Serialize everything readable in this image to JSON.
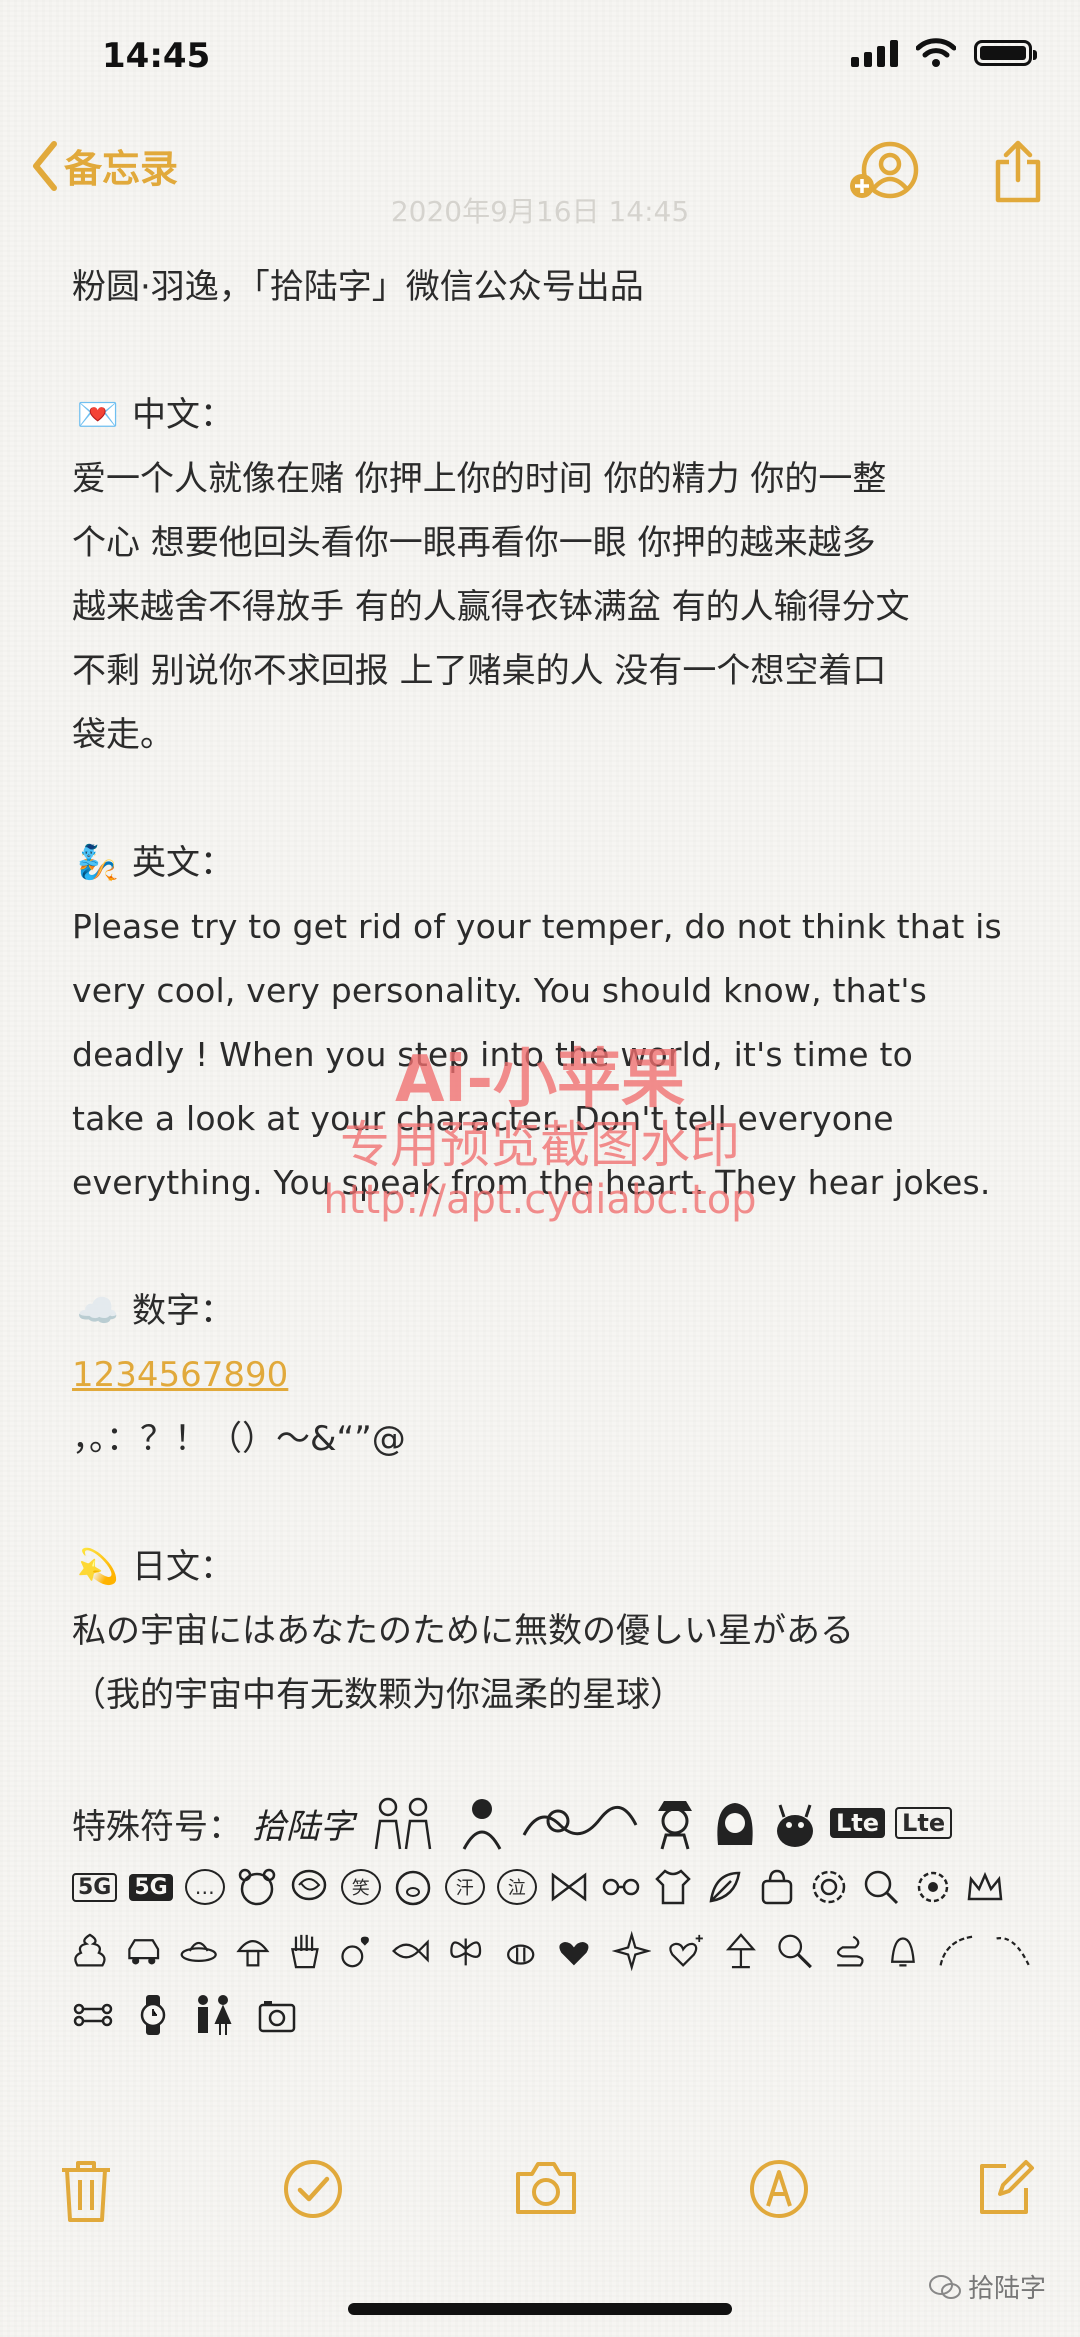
{
  "status_bar": {
    "time": "14:45"
  },
  "nav": {
    "back_label": "备忘录",
    "faded_date": "2020年9月16日 14:45"
  },
  "note": {
    "credit_line": "粉圆·羽逸，「拾陆字」微信公众号出品",
    "chinese": {
      "emoji": "💌",
      "heading": "中文：",
      "lines": [
        "爱一个人就像在赌 你押上你的时间 你的精力 你的一整",
        "个心 想要他回头看你一眼再看你一眼 你押的越来越多",
        "越来越舍不得放手 有的人赢得衣钵满盆 有的人输得分文",
        "不剩 别说你不求回报 上了赌桌的人 没有一个想空着口",
        "袋走。"
      ]
    },
    "english": {
      "emoji": "🧞",
      "heading": "英文：",
      "lines": [
        "Please try to get rid of your temper, do not think that is",
        "very cool, very personality. You should know, that's",
        "deadly ! When you step into the world, it's time to",
        "take a look at your character. Don't tell everyone",
        "everything. You speak from the heart. They hear jokes."
      ]
    },
    "numbers": {
      "emoji": "☁️",
      "heading": "数字：",
      "digits": "1234567890",
      "punctuation": "，。：？！（）～&“”@"
    },
    "japanese": {
      "emoji": "💫",
      "heading": "日文：",
      "lines": [
        "私の宇宙にはあなたのために無数の優しい星がある",
        "（我的宇宙中有无数颗为你温柔的星球）"
      ]
    },
    "special": {
      "heading": "特殊符号：",
      "brand": "拾陆字",
      "badges": [
        "Lte",
        "Lte",
        "5G",
        "5G"
      ],
      "bubbles": [
        "…",
        "笑",
        "汗",
        "泣"
      ]
    }
  },
  "watermark": {
    "line1": "Ai-小苹果",
    "line2": "专用预览截图水印",
    "line3": "http://apt.cydiabc.top"
  },
  "footer": {
    "credit": "拾陆字"
  },
  "colors": {
    "accent": "#e1a93b",
    "watermark": "#f06e6e"
  }
}
